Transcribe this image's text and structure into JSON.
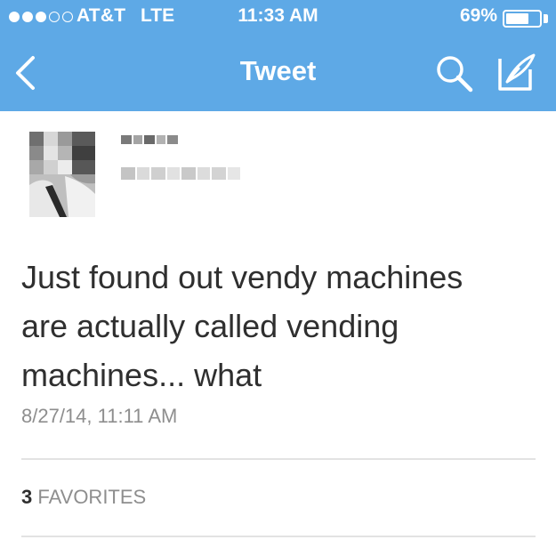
{
  "status_bar": {
    "carrier": "AT&T",
    "network": "LTE",
    "time": "11:33 AM",
    "battery_percent": "69%",
    "battery_level": 0.69,
    "signal_bars_filled": 3,
    "signal_bars_total": 5
  },
  "nav": {
    "back_icon": "chevron-left-icon",
    "title": "Tweet",
    "search_icon": "search-icon",
    "compose_icon": "compose-icon"
  },
  "tweet": {
    "avatar": "blurred-avatar",
    "text_lines": [
      "Just found out vendy machines",
      "are actually called vending",
      "machines... what"
    ],
    "timestamp": "8/27/14, 11:11 AM",
    "favorites_count": "3",
    "favorites_label": "FAVORITES"
  },
  "colors": {
    "header_bg": "#5ea9e6",
    "header_text": "#ffffff",
    "body_text": "#2f2f2f",
    "meta_text": "#8e8e8e",
    "divider": "#e3e3e3"
  }
}
